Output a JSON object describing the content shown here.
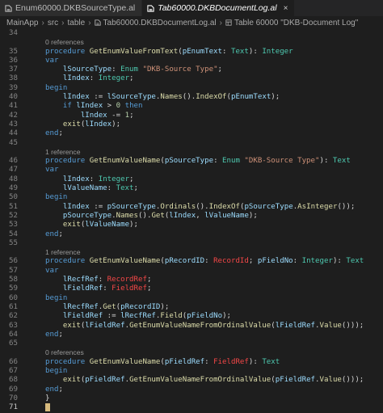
{
  "tabs": [
    {
      "label": "Enum60000.DKBSourceType.al",
      "active": false
    },
    {
      "label": "Tab60000.DKBDocumentLog.al",
      "active": true,
      "close": "×"
    }
  ],
  "breadcrumb": [
    "MainApp",
    "src",
    "table",
    "Tab60000.DKBDocumentLog.al",
    "Table 60000 \"DKB-Document Log\""
  ],
  "code_lines": [
    {
      "n": "34",
      "s": []
    },
    {
      "n": "",
      "lens": "0 references"
    },
    {
      "n": "35",
      "s": [
        [
          "k",
          "procedure "
        ],
        [
          "f",
          "GetEnumValueFromText"
        ],
        [
          "p",
          "("
        ],
        [
          "v",
          "pEnumText"
        ],
        [
          "p",
          ": "
        ],
        [
          "t",
          "Text"
        ],
        [
          "p",
          "): "
        ],
        [
          "t",
          "Integer"
        ]
      ]
    },
    {
      "n": "36",
      "s": [
        [
          "k",
          "var"
        ]
      ]
    },
    {
      "n": "37",
      "s": [
        [
          "p",
          "    "
        ],
        [
          "v",
          "lSourceType"
        ],
        [
          "p",
          ": "
        ],
        [
          "t",
          "Enum "
        ],
        [
          "s",
          "\"DKB-Source Type\""
        ],
        [
          "p",
          ";"
        ]
      ]
    },
    {
      "n": "38",
      "s": [
        [
          "p",
          "    "
        ],
        [
          "v",
          "lIndex"
        ],
        [
          "p",
          ": "
        ],
        [
          "t",
          "Integer"
        ],
        [
          "p",
          ";"
        ]
      ]
    },
    {
      "n": "39",
      "s": [
        [
          "k",
          "begin"
        ]
      ]
    },
    {
      "n": "40",
      "s": [
        [
          "p",
          "    "
        ],
        [
          "v",
          "lIndex"
        ],
        [
          "p",
          " := "
        ],
        [
          "v",
          "lSourceType"
        ],
        [
          "p",
          "."
        ],
        [
          "f",
          "Names"
        ],
        [
          "p",
          "()."
        ],
        [
          "f",
          "IndexOf"
        ],
        [
          "p",
          "("
        ],
        [
          "v",
          "pEnumText"
        ],
        [
          "p",
          ");"
        ]
      ]
    },
    {
      "n": "41",
      "s": [
        [
          "p",
          "    "
        ],
        [
          "k",
          "if "
        ],
        [
          "v",
          "lIndex"
        ],
        [
          "p",
          " > "
        ],
        [
          "n",
          "0"
        ],
        [
          "k",
          " then"
        ]
      ]
    },
    {
      "n": "42",
      "s": [
        [
          "p",
          "        "
        ],
        [
          "v",
          "lIndex"
        ],
        [
          "p",
          " -= "
        ],
        [
          "n",
          "1"
        ],
        [
          "p",
          ";"
        ]
      ]
    },
    {
      "n": "43",
      "s": [
        [
          "p",
          "    "
        ],
        [
          "f",
          "exit"
        ],
        [
          "p",
          "("
        ],
        [
          "v",
          "lIndex"
        ],
        [
          "p",
          ");"
        ]
      ]
    },
    {
      "n": "44",
      "s": [
        [
          "k",
          "end"
        ],
        [
          "p",
          ";"
        ]
      ]
    },
    {
      "n": "45",
      "s": []
    },
    {
      "n": "",
      "lens": "1 reference"
    },
    {
      "n": "46",
      "s": [
        [
          "k",
          "procedure "
        ],
        [
          "f",
          "GetEnumValueName"
        ],
        [
          "p",
          "("
        ],
        [
          "v",
          "pSourceType"
        ],
        [
          "p",
          ": "
        ],
        [
          "t",
          "Enum "
        ],
        [
          "s",
          "\"DKB-Source Type\""
        ],
        [
          "p",
          "): "
        ],
        [
          "t",
          "Text"
        ]
      ]
    },
    {
      "n": "47",
      "s": [
        [
          "k",
          "var"
        ]
      ]
    },
    {
      "n": "48",
      "s": [
        [
          "p",
          "    "
        ],
        [
          "v",
          "lIndex"
        ],
        [
          "p",
          ": "
        ],
        [
          "t",
          "Integer"
        ],
        [
          "p",
          ";"
        ]
      ]
    },
    {
      "n": "49",
      "s": [
        [
          "p",
          "    "
        ],
        [
          "v",
          "lValueName"
        ],
        [
          "p",
          ": "
        ],
        [
          "t",
          "Text"
        ],
        [
          "p",
          ";"
        ]
      ]
    },
    {
      "n": "50",
      "s": [
        [
          "k",
          "begin"
        ]
      ]
    },
    {
      "n": "51",
      "s": [
        [
          "p",
          "    "
        ],
        [
          "v",
          "lIndex"
        ],
        [
          "p",
          " := "
        ],
        [
          "v",
          "pSourceType"
        ],
        [
          "p",
          "."
        ],
        [
          "f",
          "Ordinals"
        ],
        [
          "p",
          "()."
        ],
        [
          "f",
          "IndexOf"
        ],
        [
          "p",
          "("
        ],
        [
          "v",
          "pSourceType"
        ],
        [
          "p",
          "."
        ],
        [
          "f",
          "AsInteger"
        ],
        [
          "p",
          "());"
        ]
      ]
    },
    {
      "n": "52",
      "s": [
        [
          "p",
          "    "
        ],
        [
          "v",
          "pSourceType"
        ],
        [
          "p",
          "."
        ],
        [
          "f",
          "Names"
        ],
        [
          "p",
          "()."
        ],
        [
          "f",
          "Get"
        ],
        [
          "p",
          "("
        ],
        [
          "v",
          "lIndex"
        ],
        [
          "p",
          ", "
        ],
        [
          "v",
          "lValueName"
        ],
        [
          "p",
          ");"
        ]
      ]
    },
    {
      "n": "53",
      "s": [
        [
          "p",
          "    "
        ],
        [
          "f",
          "exit"
        ],
        [
          "p",
          "("
        ],
        [
          "v",
          "lValueName"
        ],
        [
          "p",
          ");"
        ]
      ]
    },
    {
      "n": "54",
      "s": [
        [
          "k",
          "end"
        ],
        [
          "p",
          ";"
        ]
      ]
    },
    {
      "n": "55",
      "s": []
    },
    {
      "n": "",
      "lens": "1 reference"
    },
    {
      "n": "56",
      "s": [
        [
          "k",
          "procedure "
        ],
        [
          "f",
          "GetEnumValueName"
        ],
        [
          "p",
          "("
        ],
        [
          "v",
          "pRecordID"
        ],
        [
          "p",
          ": "
        ],
        [
          "e",
          "RecordId"
        ],
        [
          "p",
          "; "
        ],
        [
          "v",
          "pFieldNo"
        ],
        [
          "p",
          ": "
        ],
        [
          "t",
          "Integer"
        ],
        [
          "p",
          "): "
        ],
        [
          "t",
          "Text"
        ]
      ]
    },
    {
      "n": "57",
      "s": [
        [
          "k",
          "var"
        ]
      ]
    },
    {
      "n": "58",
      "s": [
        [
          "p",
          "    "
        ],
        [
          "v",
          "lRecfRef"
        ],
        [
          "p",
          ": "
        ],
        [
          "e",
          "RecordRef"
        ],
        [
          "p",
          ";"
        ]
      ]
    },
    {
      "n": "59",
      "s": [
        [
          "p",
          "    "
        ],
        [
          "v",
          "lFieldRef"
        ],
        [
          "p",
          ": "
        ],
        [
          "e",
          "FieldRef"
        ],
        [
          "p",
          ";"
        ]
      ]
    },
    {
      "n": "60",
      "s": [
        [
          "k",
          "begin"
        ]
      ]
    },
    {
      "n": "61",
      "s": [
        [
          "p",
          "    "
        ],
        [
          "v",
          "lRecfRef"
        ],
        [
          "p",
          "."
        ],
        [
          "f",
          "Get"
        ],
        [
          "p",
          "("
        ],
        [
          "v",
          "pRecordID"
        ],
        [
          "p",
          ");"
        ]
      ]
    },
    {
      "n": "62",
      "s": [
        [
          "p",
          "    "
        ],
        [
          "v",
          "lFieldRef"
        ],
        [
          "p",
          " := "
        ],
        [
          "v",
          "lRecfRef"
        ],
        [
          "p",
          "."
        ],
        [
          "f",
          "Field"
        ],
        [
          "p",
          "("
        ],
        [
          "v",
          "pFieldNo"
        ],
        [
          "p",
          ");"
        ]
      ]
    },
    {
      "n": "63",
      "s": [
        [
          "p",
          "    "
        ],
        [
          "f",
          "exit"
        ],
        [
          "p",
          "("
        ],
        [
          "v",
          "lFieldRef"
        ],
        [
          "p",
          "."
        ],
        [
          "f",
          "GetEnumValueNameFromOrdinalValue"
        ],
        [
          "p",
          "("
        ],
        [
          "v",
          "lFieldRef"
        ],
        [
          "p",
          "."
        ],
        [
          "f",
          "Value"
        ],
        [
          "p",
          "()));"
        ]
      ]
    },
    {
      "n": "64",
      "s": [
        [
          "k",
          "end"
        ],
        [
          "p",
          ";"
        ]
      ]
    },
    {
      "n": "65",
      "s": []
    },
    {
      "n": "",
      "lens": "0 references"
    },
    {
      "n": "66",
      "s": [
        [
          "k",
          "procedure "
        ],
        [
          "f",
          "GetEnumValueName"
        ],
        [
          "p",
          "("
        ],
        [
          "v",
          "pFieldRef"
        ],
        [
          "p",
          ": "
        ],
        [
          "e",
          "FieldRef"
        ],
        [
          "p",
          "): "
        ],
        [
          "t",
          "Text"
        ]
      ]
    },
    {
      "n": "67",
      "s": [
        [
          "k",
          "begin"
        ]
      ]
    },
    {
      "n": "68",
      "s": [
        [
          "p",
          "    "
        ],
        [
          "f",
          "exit"
        ],
        [
          "p",
          "("
        ],
        [
          "v",
          "pFieldRef"
        ],
        [
          "p",
          "."
        ],
        [
          "f",
          "GetEnumValueNameFromOrdinalValue"
        ],
        [
          "p",
          "("
        ],
        [
          "v",
          "pFieldRef"
        ],
        [
          "p",
          "."
        ],
        [
          "f",
          "Value"
        ],
        [
          "p",
          "()));"
        ]
      ]
    },
    {
      "n": "69",
      "s": [
        [
          "k",
          "end"
        ],
        [
          "p",
          ";"
        ]
      ]
    },
    {
      "n": "70",
      "s": [
        [
          "p",
          "}"
        ]
      ]
    },
    {
      "n": "71",
      "s": [],
      "caret": true
    }
  ],
  "colors": {
    "keyword": "#569cd6",
    "function": "#dcdcaa",
    "variable": "#9cdcfe",
    "type": "#4ec9b0",
    "string": "#ce9178",
    "number": "#b5cea8",
    "error": "#f44747"
  },
  "icons": {
    "tab_file": "file-al-icon",
    "breadcrumb_table": "table-icon"
  }
}
